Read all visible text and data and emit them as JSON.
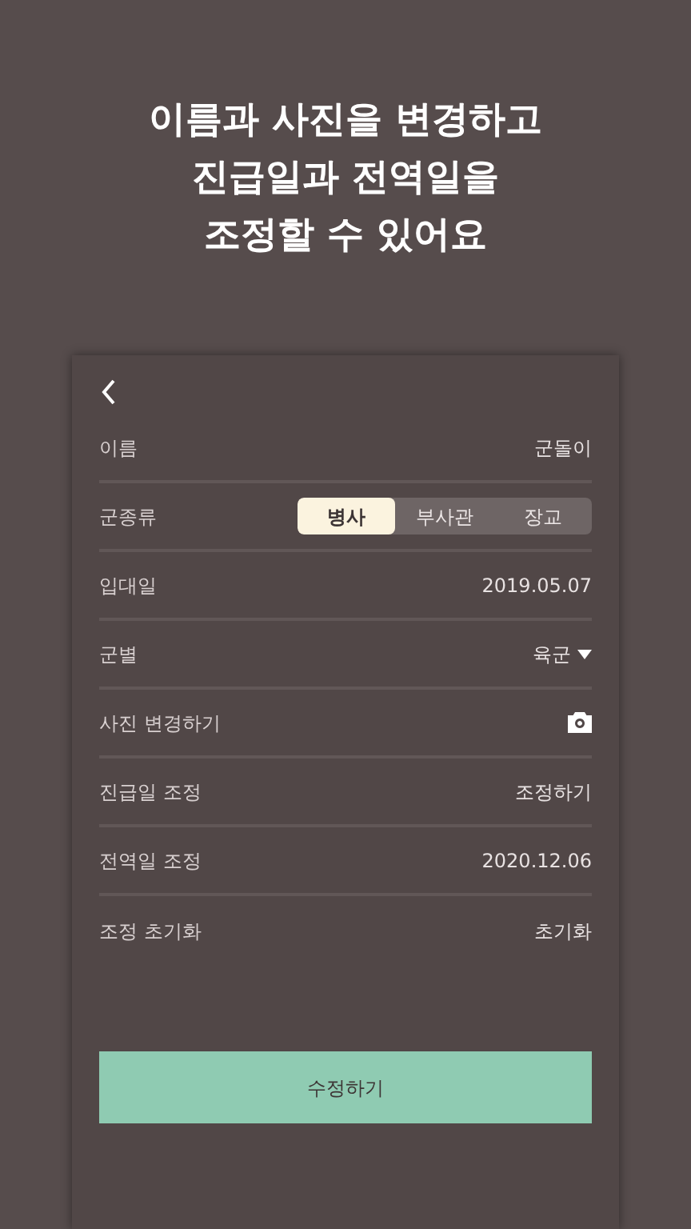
{
  "headline": [
    "이름과 사진을 변경하고",
    "진급일과 전역일을",
    "조정할 수 있어요"
  ],
  "rows": [
    {
      "kind": "text",
      "label": "이름",
      "value": "군돌이"
    },
    {
      "kind": "segment",
      "label": "군종류",
      "options": [
        {
          "label": "병사",
          "selected": true
        },
        {
          "label": "부사관",
          "selected": false
        },
        {
          "label": "장교",
          "selected": false
        }
      ]
    },
    {
      "kind": "text",
      "label": "입대일",
      "value": "2019.05.07"
    },
    {
      "kind": "dropdown",
      "label": "군별",
      "value": "육군"
    },
    {
      "kind": "camera",
      "label": "사진 변경하기"
    },
    {
      "kind": "text",
      "label": "진급일 조정",
      "value": "조정하기"
    },
    {
      "kind": "text",
      "label": "전역일 조정",
      "value": "2020.12.06"
    },
    {
      "kind": "text",
      "label": "조정 초기화",
      "value": "초기화"
    }
  ],
  "submit": "수정하기"
}
